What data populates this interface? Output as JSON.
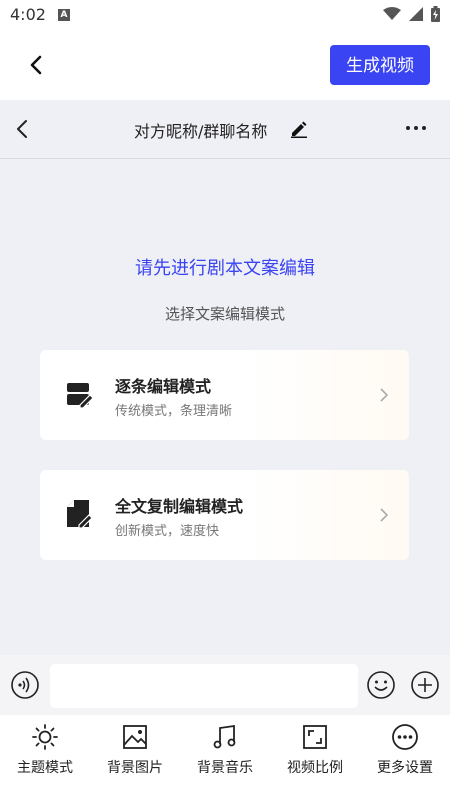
{
  "status_bar": {
    "time": "4:02",
    "notif_letter": "A"
  },
  "header": {
    "generate_button": "生成视频"
  },
  "chat": {
    "title": "对方昵称/群聊名称",
    "prompt": "请先进行剧本文案编辑",
    "subprompt": "选择文案编辑模式",
    "modes": [
      {
        "title": "逐条编辑模式",
        "subtitle": "传统模式，条理清晰",
        "icon": "list-edit-icon"
      },
      {
        "title": "全文复制编辑模式",
        "subtitle": "创新模式，速度快",
        "icon": "document-edit-icon"
      }
    ]
  },
  "input": {
    "placeholder": ""
  },
  "toolbar": {
    "items": [
      {
        "label": "主题模式",
        "icon": "sun-icon"
      },
      {
        "label": "背景图片",
        "icon": "image-icon"
      },
      {
        "label": "背景音乐",
        "icon": "music-icon"
      },
      {
        "label": "视频比例",
        "icon": "aspect-ratio-icon"
      },
      {
        "label": "更多设置",
        "icon": "more-circle-icon"
      }
    ]
  },
  "colors": {
    "accent": "#3a44f3",
    "panel_bg": "#eff0f5"
  }
}
